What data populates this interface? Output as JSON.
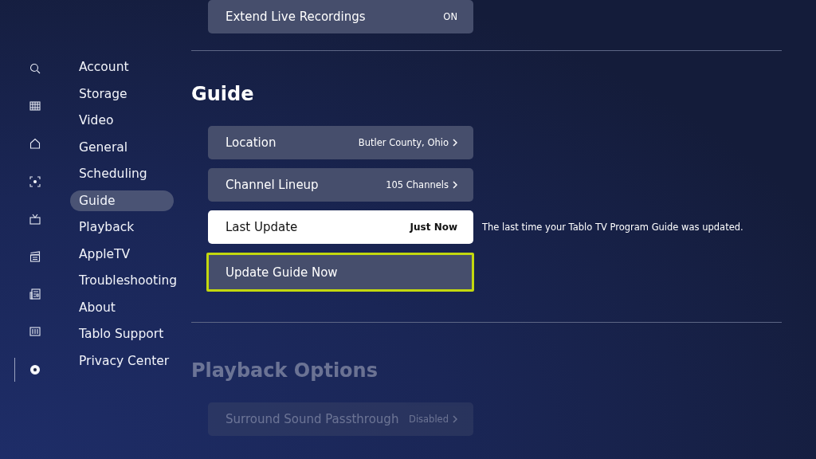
{
  "rail": [
    {
      "selected": false
    },
    {
      "selected": false
    },
    {
      "selected": false
    },
    {
      "selected": false
    },
    {
      "selected": false
    },
    {
      "selected": false
    },
    {
      "selected": false
    },
    {
      "selected": false
    },
    {
      "selected": true
    }
  ],
  "menu": [
    {
      "label": "Account",
      "selected": false
    },
    {
      "label": "Storage",
      "selected": false
    },
    {
      "label": "Video",
      "selected": false
    },
    {
      "label": "General",
      "selected": false
    },
    {
      "label": "Scheduling",
      "selected": false
    },
    {
      "label": "Guide",
      "selected": true
    },
    {
      "label": "Playback",
      "selected": false
    },
    {
      "label": "AppleTV",
      "selected": false
    },
    {
      "label": "Troubleshooting",
      "selected": false
    },
    {
      "label": "About",
      "selected": false
    },
    {
      "label": "Tablo Support",
      "selected": false
    },
    {
      "label": "Privacy Center",
      "selected": false
    }
  ],
  "sections": [
    {
      "disabled": false,
      "rows": [
        {
          "kind": "value",
          "label": "Extend Live Recordings",
          "value": "ON",
          "focused": false
        }
      ]
    },
    {
      "title": "Guide",
      "disabled": false,
      "rows": [
        {
          "kind": "link",
          "label": "Location",
          "value": "Butler County, Ohio",
          "focused": false
        },
        {
          "kind": "link",
          "label": "Channel Lineup",
          "value": "105 Channels",
          "focused": false
        },
        {
          "kind": "info",
          "label": "Last Update",
          "value": "Just Now",
          "description": "The last time your Tablo TV Program Guide was updated.",
          "focused": false
        },
        {
          "kind": "action",
          "label": "Update Guide Now",
          "focused": true
        }
      ]
    },
    {
      "title": "Playback Options",
      "disabled": true,
      "rows": [
        {
          "kind": "link",
          "label": "Surround Sound Passthrough",
          "value": "Disabled",
          "focused": false
        }
      ]
    }
  ]
}
